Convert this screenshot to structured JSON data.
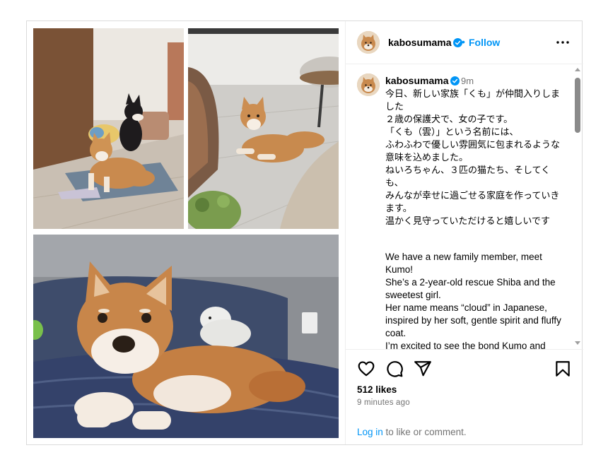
{
  "post": {
    "username": "kabosumama",
    "verified": true,
    "follow_label": "Follow",
    "dot": "•",
    "more_label": "More options"
  },
  "caption": {
    "username": "kabosumama",
    "time": "9m",
    "text_ja": "今日、新しい家族「くも」が仲間入りしました\n２歳の保護犬で、女の子です。\n「くも（雲）」という名前には、\nふわふわで優しい雰囲気に包まれるような意味を込めました。\nねいろちゃん、３匹の猫たち、そしてくも、\nみんなが幸せに過ごせる家庭を作っていきます。\n温かく見守っていただけると嬉しいです",
    "text_en": "We have a new family member, meet Kumo!\nShe’s a 2-year-old rescue Shiba and the sweetest girl.\nHer name means “cloud” in Japanese, inspired by her soft, gentle spirit and fluffy coat.\nI’m excited to see the bond Kumo and"
  },
  "stats": {
    "likes": "512 likes",
    "time_ago": "9 minutes ago"
  },
  "login": {
    "link": "Log in",
    "rest": " to like or comment."
  },
  "colors": {
    "accent": "#0095f6",
    "muted": "#737373",
    "border": "#dbdbdb"
  },
  "icons": [
    "heart-icon",
    "comment-icon",
    "share-icon",
    "bookmark-icon",
    "more-icon",
    "verified-badge-icon"
  ]
}
